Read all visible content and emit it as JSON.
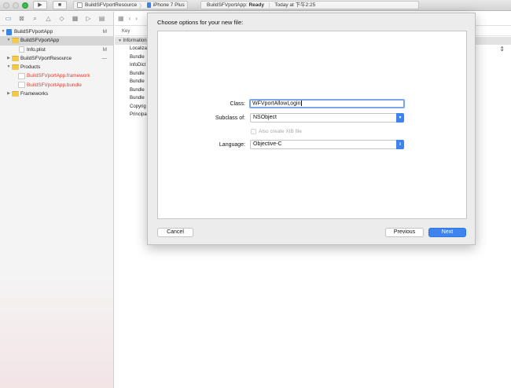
{
  "toolbar": {
    "scheme": "BuildSFVportResource",
    "device": "iPhone 7 Plus",
    "status_project": "BuildSFVportApp:",
    "status_state": "Ready",
    "status_time": "Today at 下午2:25"
  },
  "navigator": {
    "items": [
      {
        "label": "BuildSFVportApp",
        "badge": "M"
      },
      {
        "label": "BuildSFVportApp",
        "badge": ""
      },
      {
        "label": "Info.plist",
        "badge": "M"
      },
      {
        "label": "BuildSFVportResource",
        "badge": "—"
      },
      {
        "label": "Products",
        "badge": ""
      },
      {
        "label": "BuildSFVportApp.framework",
        "badge": ""
      },
      {
        "label": "BuildSFVportApp.bundle",
        "badge": ""
      },
      {
        "label": "Frameworks",
        "badge": ""
      }
    ]
  },
  "plist": {
    "header_key": "Key",
    "section": "Information",
    "keys": [
      "Localiza",
      "Bundle",
      "InfoDict",
      "Bundle",
      "Bundle",
      "Bundle",
      "Bundle",
      "Copyrig",
      "Principa"
    ]
  },
  "sheet": {
    "title": "Choose options for your new file:",
    "class_label": "Class:",
    "class_value": "WFVportAllowLogin",
    "subclass_label": "Subclass of:",
    "subclass_value": "NSObject",
    "xib_label": "Also create XIB file",
    "language_label": "Language:",
    "language_value": "Objective-C",
    "cancel": "Cancel",
    "previous": "Previous",
    "next": "Next"
  }
}
